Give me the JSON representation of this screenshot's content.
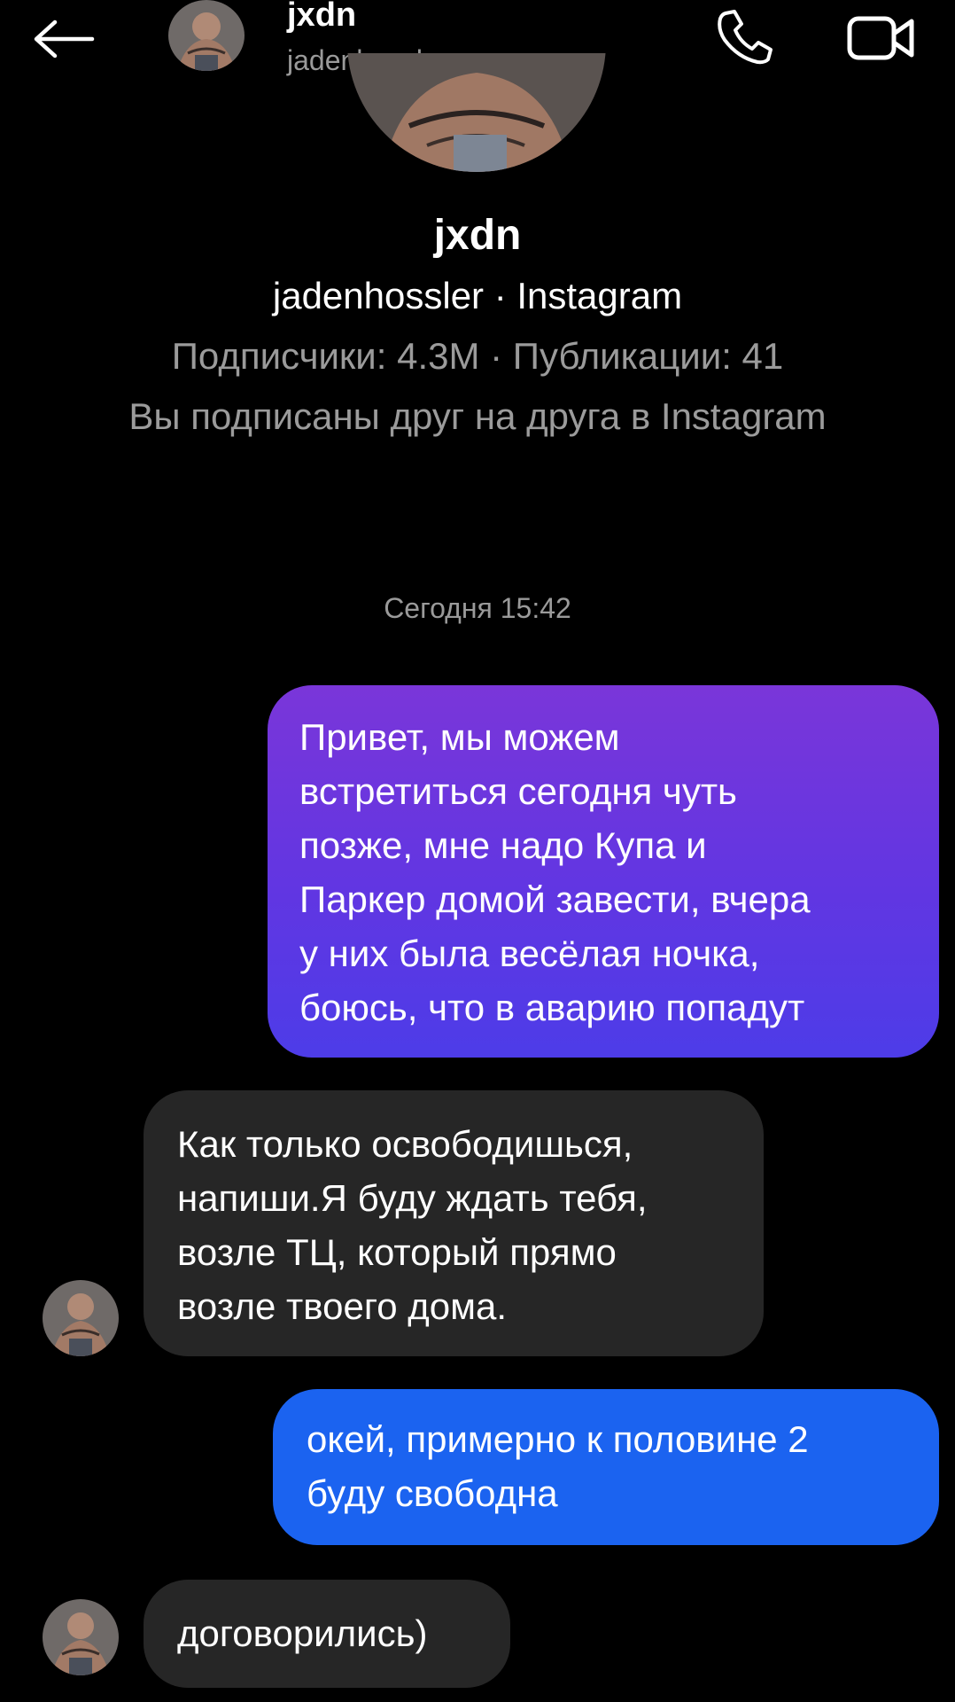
{
  "header": {
    "name": "jxdn",
    "username": "jadenhossler",
    "back_icon": "arrow-left-icon",
    "call_icon": "phone-icon",
    "video_icon": "video-camera-icon"
  },
  "profile": {
    "name": "jxdn",
    "subtitle": "jadenhossler · Instagram",
    "stats": "Подписчики: 4.3M · Публикации: 41",
    "mutual": "Вы подписаны друг на друга в Instagram"
  },
  "timestamp": "Сегодня 15:42",
  "messages": [
    {
      "direction": "outgoing",
      "lines": [
        "Привет, мы можем",
        "встретиться сегодня чуть",
        "позже, мне надо Купа и",
        "Паркер домой завести, вчера",
        "у них была весёлая ночка,",
        "боюсь, что в аварию попадут"
      ]
    },
    {
      "direction": "incoming",
      "lines": [
        "Как только освободишься,",
        "напиши.Я буду ждать тебя,",
        "возле ТЦ, который прямо",
        "возле твоего дома."
      ]
    },
    {
      "direction": "outgoing",
      "lines": [
        "окей, примерно к половине 2",
        "буду свободна"
      ]
    },
    {
      "direction": "incoming",
      "lines": [
        "договорились)"
      ]
    }
  ],
  "colors": {
    "background": "#000000",
    "outgoing_gradient_top": "#7a36d9",
    "outgoing_gradient_bottom": "#4d3ce8",
    "outgoing_blue": "#1b63f0",
    "incoming": "#262626",
    "muted_text": "#9b9b9b"
  }
}
